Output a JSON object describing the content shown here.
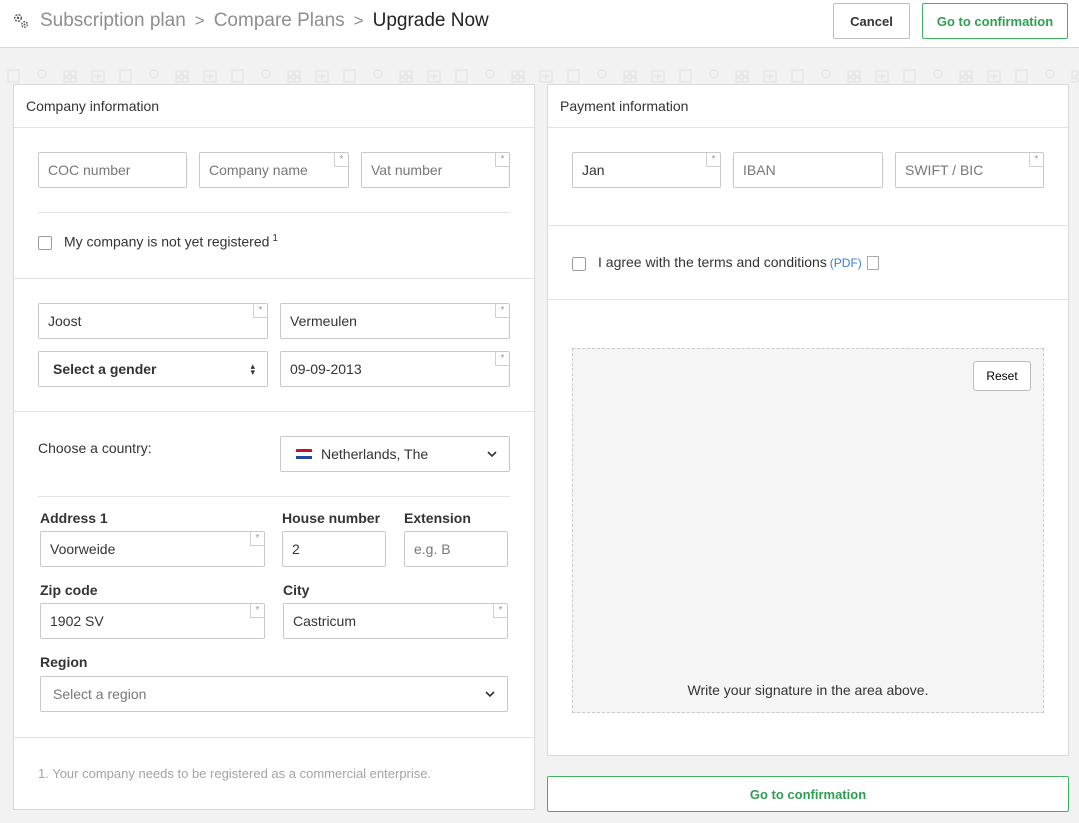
{
  "breadcrumb": {
    "items": [
      "Subscription plan",
      "Compare Plans",
      "Upgrade Now"
    ],
    "separator": ">"
  },
  "header_buttons": {
    "cancel": "Cancel",
    "confirm": "Go to confirmation"
  },
  "company": {
    "title": "Company information",
    "coc_placeholder": "COC number",
    "company_name_placeholder": "Company name",
    "vat_placeholder": "Vat number",
    "not_registered_label": "My company is not yet registered",
    "not_registered_sup": "1",
    "first_name": "Joost",
    "last_name": "Vermeulen",
    "gender": "Select a gender",
    "birth_date": "09-09-2013",
    "country_label": "Choose a country:",
    "country": "Netherlands, The",
    "address1_label": "Address 1",
    "address1": "Voorweide",
    "house_number_label": "House number",
    "house_number": "2",
    "extension_label": "Extension",
    "extension_placeholder": "e.g. B",
    "zip_label": "Zip code",
    "zip": "1902 SV",
    "city_label": "City",
    "city": "Castricum",
    "region_label": "Region",
    "region_placeholder": "Select a region",
    "footnote": "1. Your company needs to be registered as a commercial enterprise."
  },
  "payment": {
    "title": "Payment information",
    "name": "Jan",
    "iban_placeholder": "IBAN",
    "swift_placeholder": "SWIFT / BIC",
    "terms_label": "I agree with the terms and conditions",
    "pdf_link": "(PDF)",
    "reset_button": "Reset",
    "signature_hint": "Write your signature in the area above."
  },
  "footer_button": "Go to confirmation",
  "colors": {
    "accent_green": "#3cb462",
    "link_blue": "#3b7dc4"
  }
}
